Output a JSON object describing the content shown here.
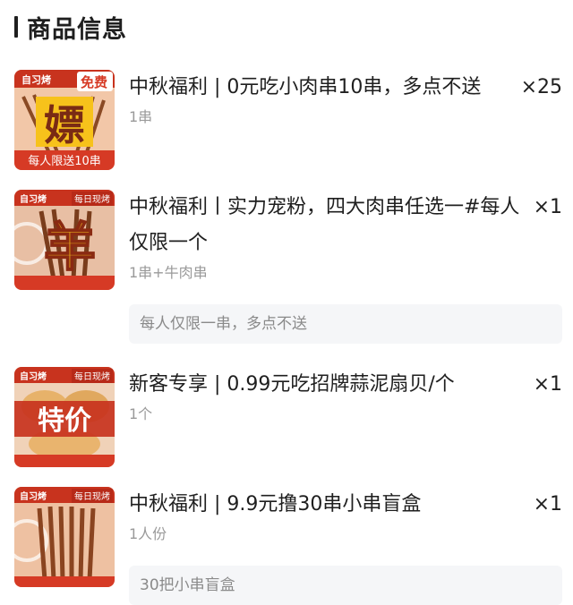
{
  "section": {
    "title": "商品信息"
  },
  "items": [
    {
      "thumb": {
        "badge": "免费",
        "big_char": "嫖",
        "banner": "每人限送10串",
        "shop": "自习烤"
      },
      "title": "中秋福利 | 0元吃小肉串10串，多点不送",
      "qty": "×25",
      "spec": "1串",
      "note": null
    },
    {
      "thumb": {
        "top_right": "每日现烤",
        "big_char": "羊",
        "banner": "",
        "shop": "自习烤"
      },
      "title": "中秋福利丨实力宠粉，四大肉串任选一#每人仅限一个",
      "qty": "×1",
      "spec": "1串+牛肉串",
      "note": "每人仅限一串，多点不送"
    },
    {
      "thumb": {
        "top_right": "每日现烤",
        "big_char": "特价",
        "banner": "",
        "shop": "自习烤"
      },
      "title": "新客专享 | 0.99元吃招牌蒜泥扇贝/个",
      "qty": "×1",
      "spec": "1个",
      "note": null
    },
    {
      "thumb": {
        "top_right": "每日现烤",
        "big_char": "",
        "banner": "",
        "shop": "自习烤"
      },
      "title": "中秋福利 | 9.9元撸30串小串盲盒",
      "qty": "×1",
      "spec": "1人份",
      "note": "30把小串盲盒"
    }
  ],
  "colors": {
    "thumb_red": "#c8331e",
    "thumb_bg": "#f2c7a8",
    "banner_red": "#d63a25",
    "yellow": "#f7c21b"
  }
}
